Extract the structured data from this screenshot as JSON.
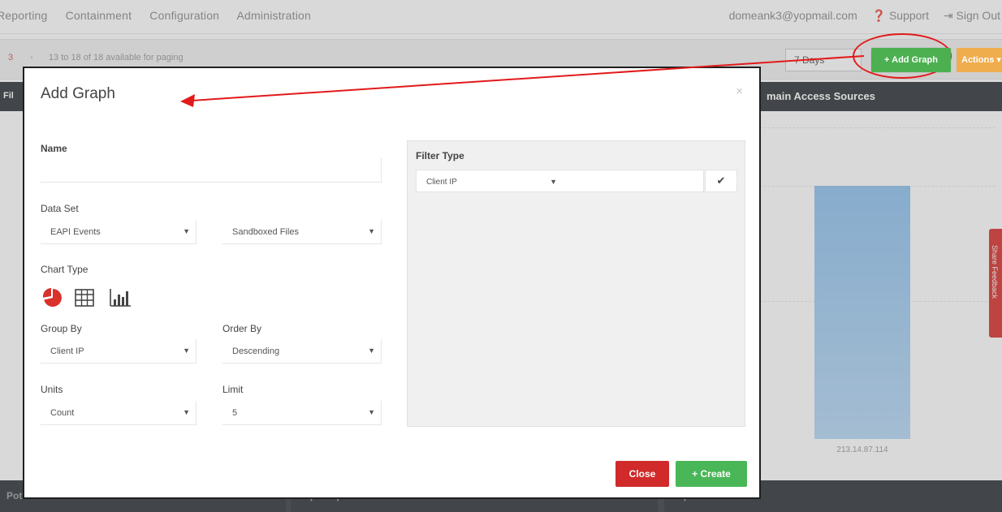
{
  "topbar": {
    "nav": [
      "Reporting",
      "Containment",
      "Configuration",
      "Administration"
    ],
    "user_email": "domeank3@yopmail.com",
    "support": "Support",
    "sign_out": "Sign Out"
  },
  "pager": {
    "current_page": "3",
    "info": "13 to 18 of 18 available for paging"
  },
  "toolbar": {
    "range": "7 Days",
    "add_graph": "+ Add Graph",
    "actions": "Actions"
  },
  "widgets": {
    "right_title": "main Access Sources",
    "left_title": "Fil",
    "bar_label": "213.14.87.114",
    "bottom_left": "Potential Domains",
    "bottom_mid": "Top Suspicious & Malicious Access Sources",
    "bottom_right": "Top"
  },
  "feedback": {
    "label": "Share Feedback"
  },
  "modal": {
    "title": "Add Graph",
    "close_x": "×",
    "name_label": "Name",
    "name_value": "",
    "dataset_label": "Data Set",
    "dataset_primary": "EAPI Events",
    "dataset_secondary": "Sandboxed Files",
    "chart_type_label": "Chart Type",
    "chart_types": [
      "pie-chart-icon",
      "table-icon",
      "bar-chart-icon"
    ],
    "group_by_label": "Group By",
    "group_by_value": "Client IP",
    "order_by_label": "Order By",
    "order_by_value": "Descending",
    "units_label": "Units",
    "units_value": "Count",
    "limit_label": "Limit",
    "limit_value": "5",
    "filter_type_label": "Filter Type",
    "filter_type_value": "Client IP",
    "close_button": "Close",
    "create_button": "+ Create"
  },
  "colors": {
    "add_graph_green": "#4cb050",
    "actions_orange": "#f0ad4e",
    "close_red": "#d02a2a",
    "create_green": "#49b657",
    "annotation_red": "#e21a1a",
    "pie_red": "#d9312b"
  }
}
